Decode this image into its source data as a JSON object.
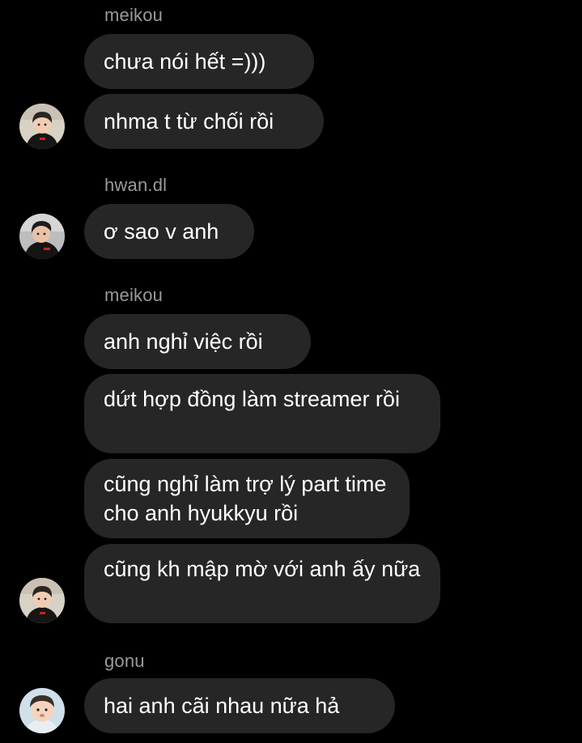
{
  "theme": {
    "background": "#000000",
    "bubble_color": "#262626",
    "sender_color": "#9a9a9a",
    "text_color": "#ffffff"
  },
  "groups": [
    {
      "sender": "meikou",
      "messages": [
        "chưa nói hết =)))",
        "nhma t từ chối rồi"
      ]
    },
    {
      "sender": "hwan.dl",
      "messages": [
        "ơ sao v anh"
      ]
    },
    {
      "sender": "meikou",
      "messages": [
        "anh nghỉ việc rồi",
        "dứt hợp đồng làm streamer rồi",
        "cũng nghỉ làm trợ lý part time cho anh hyukkyu rồi",
        "cũng kh mập mờ với anh ấy nữa"
      ]
    },
    {
      "sender": "gonu",
      "messages": [
        "hai anh cãi nhau nữa hả"
      ]
    }
  ],
  "avatars": {
    "meikou": "avatar-meikou-icon",
    "hwan": "avatar-hwan-icon",
    "gonu": "avatar-gonu-icon"
  }
}
